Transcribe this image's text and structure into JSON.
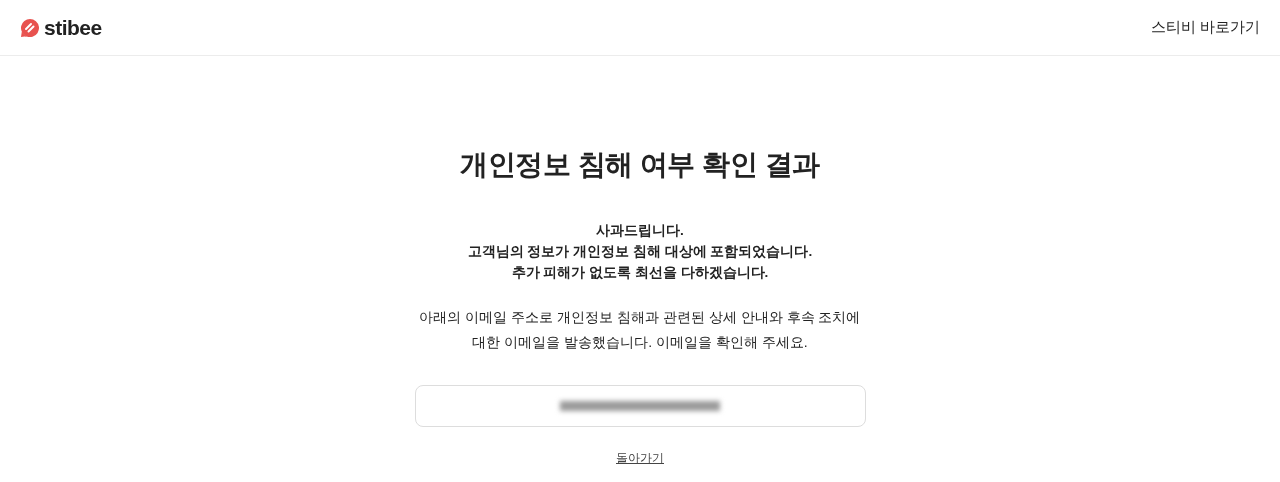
{
  "header": {
    "logo_text": "stibee",
    "link": "스티비 바로가기"
  },
  "title": "개인정보 침해 여부 확인 결과",
  "notice_lines": [
    "사과드립니다.",
    "고객님의 정보가 개인정보 침해 대상에 포함되었습니다.",
    "추가 피해가 없도록 최선을 다하겠습니다."
  ],
  "description": "아래의 이메일 주소로 개인정보 침해과 관련된 상세 안내와 후속 조치에 대한 이메일을 발송했습니다. 이메일을 확인해 주세요.",
  "email_box": {
    "redacted": true
  },
  "back_link": "돌아가기"
}
